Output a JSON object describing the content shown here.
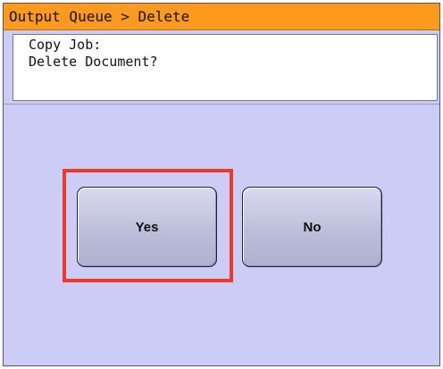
{
  "title_bar": {
    "text": "Output Queue > Delete"
  },
  "message": {
    "line1": "Copy Job:",
    "line2": "Delete Document?"
  },
  "buttons": {
    "yes_label": "Yes",
    "no_label": "No"
  },
  "colors": {
    "title_bar_bg": "#fb9a1c",
    "panel_bg": "#cccdf7",
    "highlight": "#ee3a22"
  }
}
